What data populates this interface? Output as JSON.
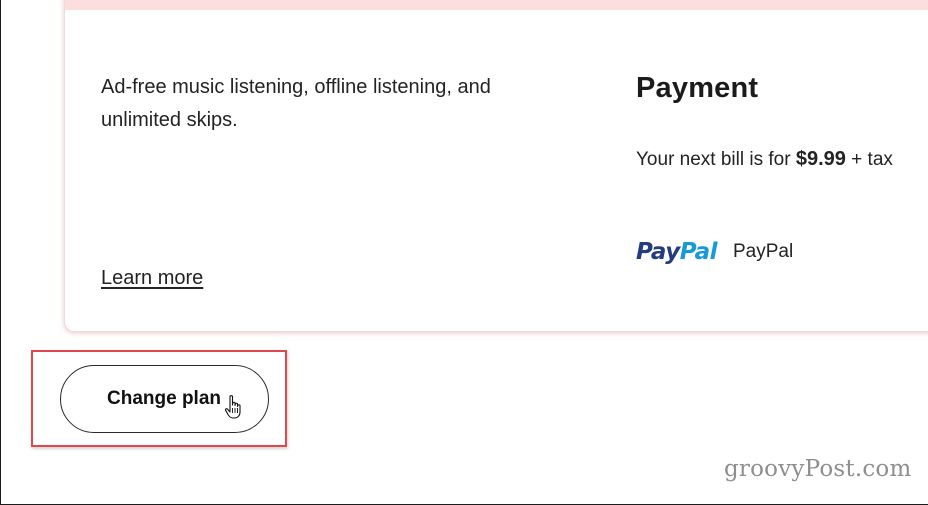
{
  "plan": {
    "description": "Ad-free music listening, offline listening, and unlimited skips.",
    "learn_more_label": "Learn more"
  },
  "payment": {
    "title": "Payment",
    "next_bill_prefix": "Your next bill is for ",
    "amount": "$9.99",
    "next_bill_suffix": " + tax",
    "method_logo_pay": "Pay",
    "method_logo_pal": "Pal",
    "method_name": "PayPal"
  },
  "actions": {
    "change_plan_label": "Change plan"
  },
  "watermark": "groovyPost.com",
  "colors": {
    "card_top_bar": "#fddede",
    "highlight_border": "#e0494c",
    "paypal_dark_blue": "#253b80",
    "paypal_light_blue": "#179bd7"
  },
  "icons": {
    "cursor": "hand-pointer-icon"
  }
}
